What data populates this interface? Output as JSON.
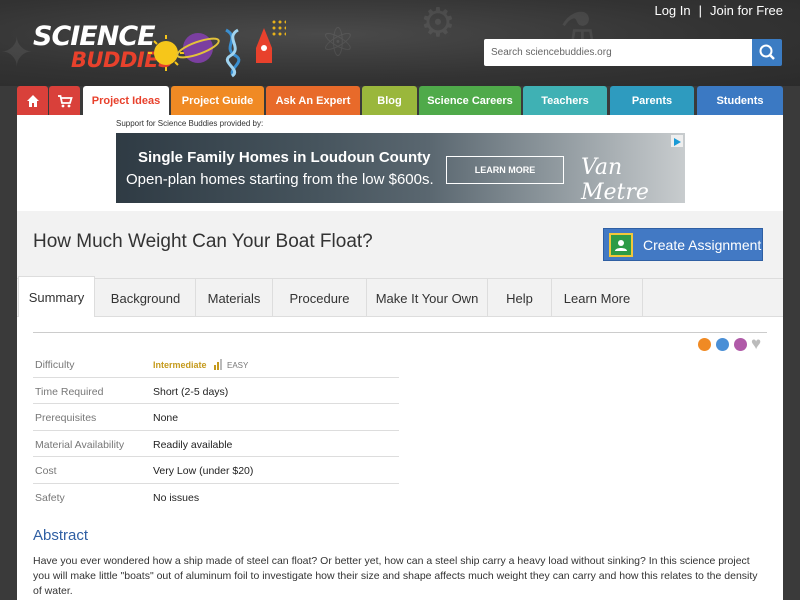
{
  "header": {
    "logo_line1": "SCIENCE",
    "logo_line2": "BUDDIES",
    "login": "Log In",
    "separator": "|",
    "join": "Join for Free",
    "search_placeholder": "Search sciencebuddies.org"
  },
  "nav": {
    "tabs": [
      {
        "label": "Project Ideas",
        "color": "#ffffff"
      },
      {
        "label": "Project Guide",
        "color": "#f08a24"
      },
      {
        "label": "Ask An Expert",
        "color": "#e86a2a"
      },
      {
        "label": "Blog",
        "color": "#9ab73c"
      },
      {
        "label": "Science Careers",
        "color": "#4faa4a"
      },
      {
        "label": "Teachers",
        "color": "#3fb1b4"
      },
      {
        "label": "Parents",
        "color": "#2e9bbf"
      },
      {
        "label": "Students",
        "color": "#3b79c3"
      }
    ],
    "home_color": "#d9403a",
    "cart_color": "#d9403a"
  },
  "ad": {
    "label": "Support for Science Buddies provided by:",
    "title": "Single Family Homes in Loudoun County",
    "subtitle": "Open-plan homes starting from the low $600s.",
    "button": "LEARN MORE",
    "brand": "Van Metre"
  },
  "page": {
    "title": "How Much Weight Can Your Boat Float?",
    "assign_button": "Create Assignment"
  },
  "subtabs": [
    "Summary",
    "Background",
    "Materials",
    "Procedure",
    "Make It Your Own",
    "Help",
    "Learn More"
  ],
  "facts": [
    {
      "key": "Difficulty",
      "value": "Intermediate"
    },
    {
      "key": "Time Required",
      "value": "Short (2-5 days)"
    },
    {
      "key": "Prerequisites",
      "value": "None"
    },
    {
      "key": "Material Availability",
      "value": "Readily available"
    },
    {
      "key": "Cost",
      "value": "Very Low (under $20)"
    },
    {
      "key": "Safety",
      "value": "No issues"
    }
  ],
  "difficulty_level": "EASY",
  "abstract": {
    "heading": "Abstract",
    "text": "Have you ever wondered how a ship made of steel can float? Or better yet, how can a steel ship carry a heavy load without sinking? In this science project you will make little \"boats\" out of aluminum foil to investigate how their size and shape affects much weight they can carry and how this relates to the density of water."
  }
}
